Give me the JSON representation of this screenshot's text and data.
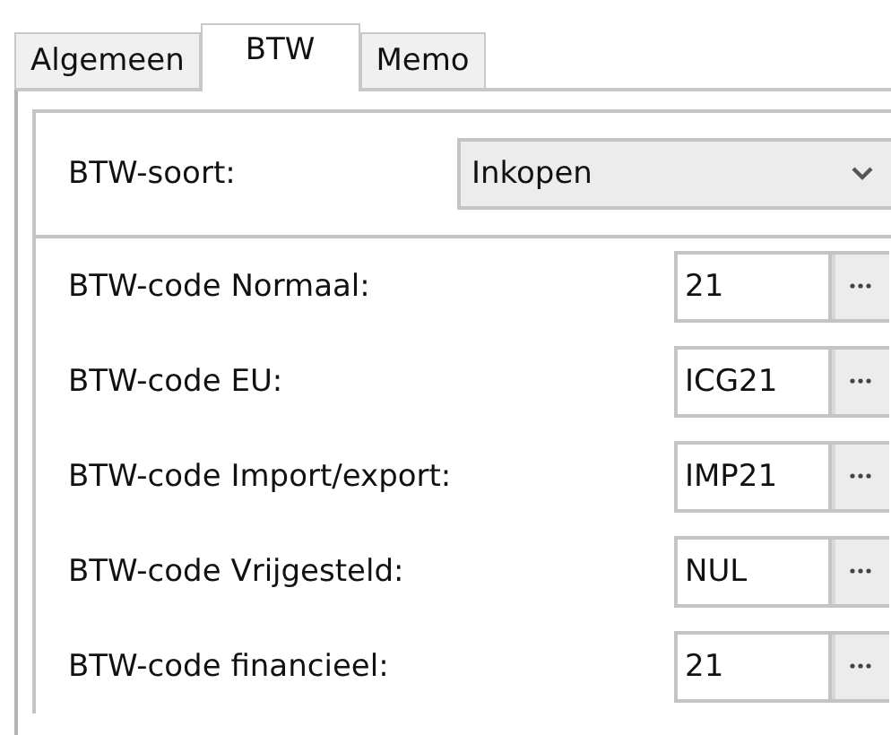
{
  "tabs": [
    {
      "label": "Algemeen",
      "selected": false
    },
    {
      "label": "BTW",
      "selected": true
    },
    {
      "label": "Memo",
      "selected": false
    }
  ],
  "vat_type": {
    "label": "BTW-soort:",
    "value": "Inkopen"
  },
  "code_rows": [
    {
      "label": "BTW-code Normaal:",
      "value": "21"
    },
    {
      "label": "BTW-code EU:",
      "value": "ICG21"
    },
    {
      "label": "BTW-code Import/export:",
      "value": "IMP21"
    },
    {
      "label": "BTW-code Vrijgesteld:",
      "value": "NUL"
    },
    {
      "label": "BTW-code financieel:",
      "value": "21"
    }
  ]
}
